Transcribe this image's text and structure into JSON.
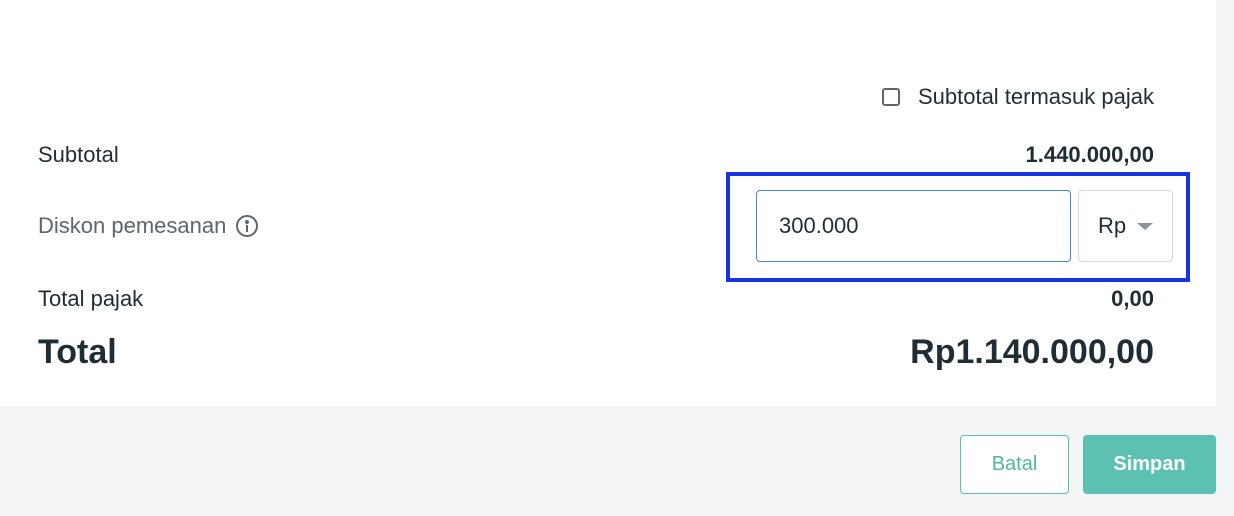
{
  "tax_inclusive": {
    "label": "Subtotal termasuk pajak",
    "checked": false
  },
  "subtotal": {
    "label": "Subtotal",
    "value": "1.440.000,00"
  },
  "discount": {
    "label": "Diskon pemesanan",
    "icon": "info-icon",
    "value": "300.000",
    "currency": "Rp",
    "highlight_color": "#1733e6"
  },
  "tax_total": {
    "label": "Total pajak",
    "value": "0,00"
  },
  "total": {
    "label": "Total",
    "value": "Rp1.140.000,00"
  },
  "actions": {
    "cancel_label": "Batal",
    "save_label": "Simpan",
    "accent_color": "#5cc1b0"
  }
}
